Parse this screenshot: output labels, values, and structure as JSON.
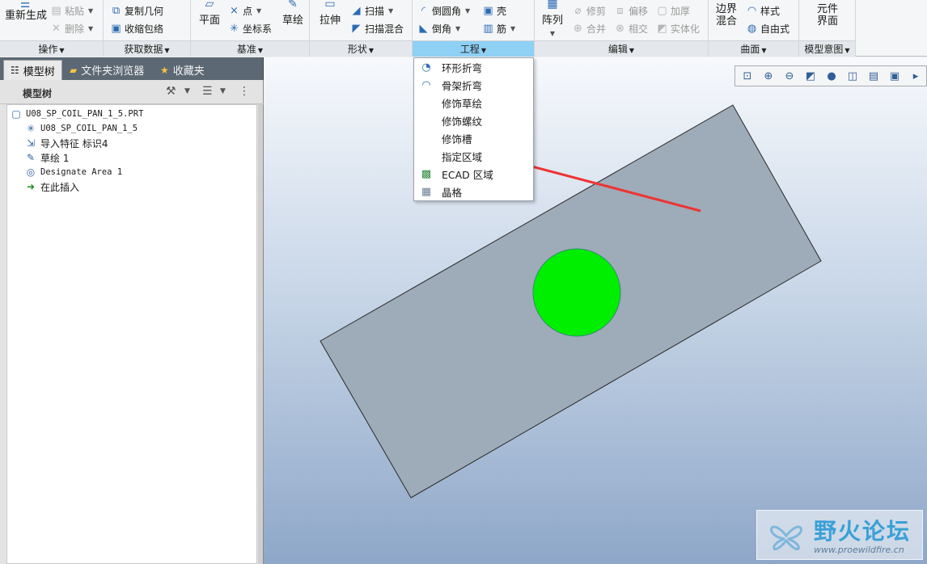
{
  "ribbon": {
    "groups": {
      "operations": {
        "label": "操作",
        "regen": "重新生成",
        "paste": "粘贴",
        "delete": "删除"
      },
      "get_data": {
        "label": "获取数据",
        "copy_geom": "复制几何",
        "shrinkwrap": "收缩包络"
      },
      "datum": {
        "label": "基准",
        "plane": "平面",
        "point": "点",
        "csys": "坐标系",
        "sketch": "草绘"
      },
      "shapes": {
        "label": "形状",
        "extrude": "拉伸",
        "sweep": "扫描",
        "swept_blend": "扫描混合"
      },
      "engineering": {
        "label": "工程",
        "round": "倒圆角",
        "shell": "壳",
        "chamfer": "倒角",
        "rib": "筋"
      },
      "editing": {
        "label": "编辑",
        "pattern": "阵列",
        "trim": "修剪",
        "offset": "偏移",
        "thicken": "加厚",
        "merge": "合并",
        "intersect": "相交",
        "solidify": "实体化"
      },
      "surfaces": {
        "label": "曲面",
        "boundary_blend_1": "边界",
        "boundary_blend_2": "混合",
        "style": "样式",
        "freestyle": "自由式"
      },
      "model_intent": {
        "label": "模型意图",
        "component_1": "元件",
        "component_2": "界面"
      }
    }
  },
  "tabs": {
    "model_tree": "模型树",
    "folder_browser": "文件夹浏览器",
    "favorites": "收藏夹"
  },
  "tree": {
    "title": "模型树",
    "items": [
      {
        "label": "U08_SP_COIL_PAN_1_5.PRT",
        "icon": "part-icon"
      },
      {
        "label": "U08_SP_COIL_PAN_1_5",
        "icon": "csys-icon"
      },
      {
        "label": "导入特征 标识4",
        "icon": "import-feature-icon"
      },
      {
        "label": "草绘 1",
        "icon": "sketch-icon"
      },
      {
        "label": "Designate Area 1",
        "icon": "designate-area-icon"
      },
      {
        "label": "在此插入",
        "icon": "insert-here-arrow-icon"
      }
    ]
  },
  "menu": {
    "items": [
      {
        "label": "环形折弯",
        "icon": "toroidal-bend-icon"
      },
      {
        "label": "骨架折弯",
        "icon": "spinal-bend-icon"
      },
      {
        "label": "修饰草绘",
        "icon": ""
      },
      {
        "label": "修饰螺纹",
        "icon": ""
      },
      {
        "label": "修饰槽",
        "icon": ""
      },
      {
        "label": "指定区域",
        "icon": ""
      },
      {
        "label": "ECAD 区域",
        "icon": "ecad-area-icon"
      },
      {
        "label": "晶格",
        "icon": "lattice-icon"
      }
    ]
  },
  "viewport": {
    "colors": {
      "plate_fill": "#9eabb8",
      "circle_fill": "#00ee00",
      "arrow": "#ee3333"
    }
  },
  "watermark": {
    "text": "野火论坛",
    "url": "www.proewildfire.cn"
  }
}
